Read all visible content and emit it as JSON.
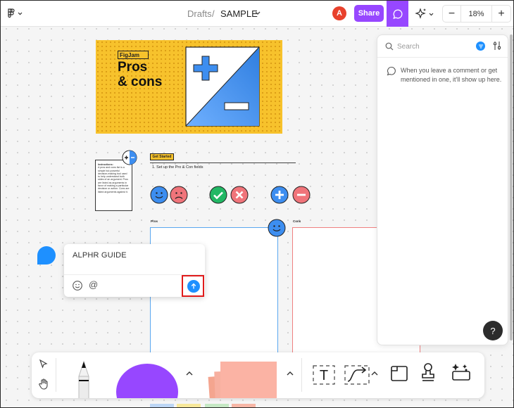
{
  "topbar": {
    "breadcrumb_drafts": "Drafts",
    "breadcrumb_sep": "/",
    "file_name": "SAMPLE",
    "avatar_initial": "A",
    "share_label": "Share",
    "zoom_value": "18%",
    "zoom_minus": "−",
    "zoom_plus": "+",
    "accent_color": "#9747ff"
  },
  "canvas": {
    "hero": {
      "tag": "FigJam",
      "title_line1": "Pros",
      "title_line2": "& cons"
    },
    "instructions": {
      "title": "Instructions:",
      "body": "A pros and cons list is a simple but powerful decision-making tool used to help understand both sides of an argument. Pros are listed as arguments in favor of making a particular decision or action. Cons are listed arguments against it."
    },
    "get_started": {
      "tag": "Get Started",
      "step1": "1. Set up the Pro & Con fields"
    },
    "columns": {
      "pros_label": "Pros",
      "cons_label": "Cons"
    },
    "stickers": [
      "smiley-blue",
      "frown-red",
      "check-green",
      "x-red",
      "plus-blue",
      "minus-red"
    ]
  },
  "composer": {
    "text": "ALPHR GUIDE",
    "at_symbol": "@"
  },
  "comments_panel": {
    "search_placeholder": "Search",
    "empty_message": "When you leave a comment or get mentioned in one, it'll show up here.",
    "help_label": "?"
  },
  "toolbar": {
    "tools": [
      "select-tool",
      "hand-tool",
      "pen-tool",
      "shape-tool",
      "sticky-note-tool",
      "text-tool",
      "connector-tool",
      "section-tool",
      "stamp-tool",
      "widgets-tool"
    ],
    "text_tool_glyph": "T"
  }
}
